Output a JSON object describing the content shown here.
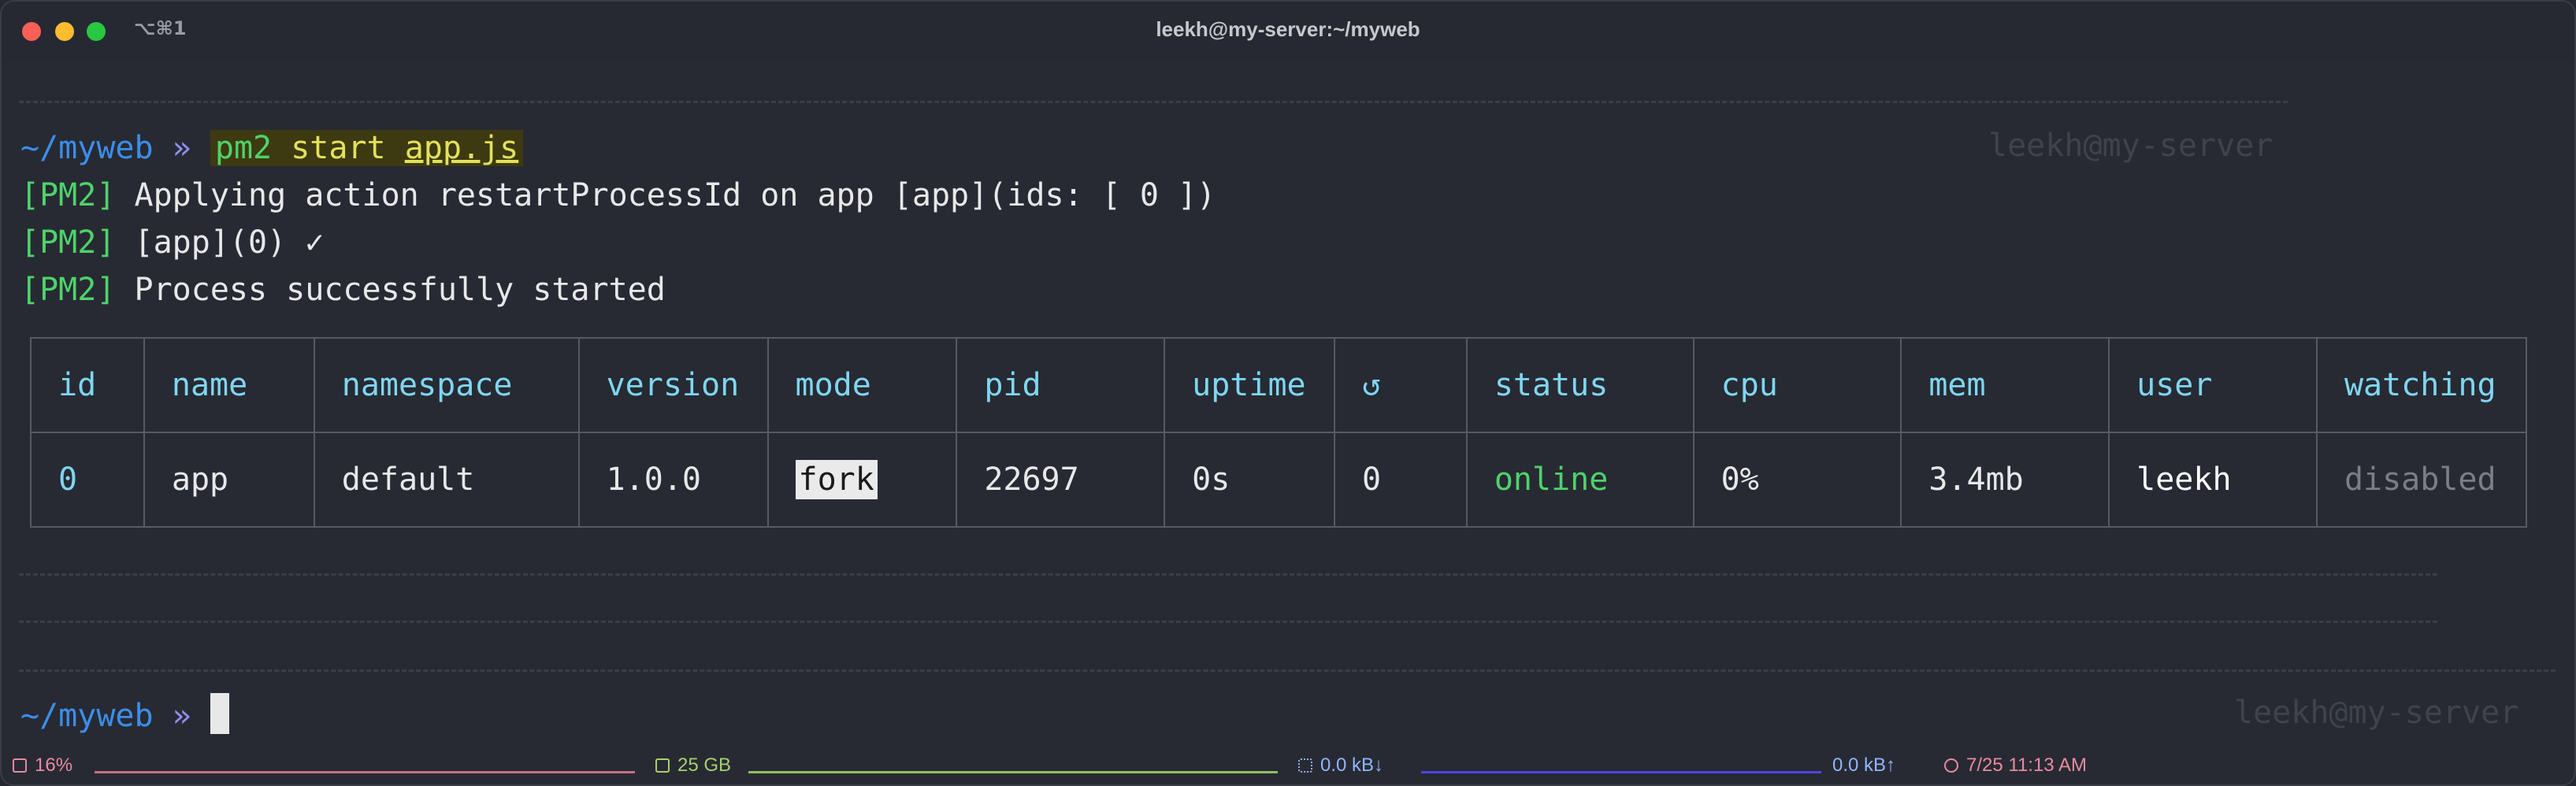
{
  "window": {
    "shortcut": "⌥⌘1",
    "title": "leekh@my-server:~/myweb"
  },
  "prompt1": {
    "dir": "~/myweb",
    "chevron": "»",
    "cmd_pm2": "pm2",
    "cmd_start": "start",
    "cmd_file": "app.js",
    "right": "leekh@my-server"
  },
  "output": [
    {
      "tag": "[PM2]",
      "text": "Applying action restartProcessId on app [app](ids: [ 0 ])"
    },
    {
      "tag": "[PM2]",
      "text": "[app](0) ✓"
    },
    {
      "tag": "[PM2]",
      "text": "Process successfully started"
    }
  ],
  "table": {
    "headers": [
      "id",
      "name",
      "namespace",
      "version",
      "mode",
      "pid",
      "uptime",
      "↺",
      "status",
      "cpu",
      "mem",
      "user",
      "watching"
    ],
    "row": {
      "id": "0",
      "name": "app",
      "namespace": "default",
      "version": "1.0.0",
      "mode": "fork",
      "pid": "22697",
      "uptime": "0s",
      "restarts": "0",
      "status": "online",
      "cpu": "0%",
      "mem": "3.4mb",
      "user": "leekh",
      "watching": "disabled"
    }
  },
  "prompt2": {
    "dir": "~/myweb",
    "chevron": "»",
    "right": "leekh@my-server"
  },
  "statusbar": {
    "cpu": "16%",
    "ram": "25 GB",
    "net_down": "0.0 kB↓",
    "net_up": "0.0 kB↑",
    "time": "7/25 11:13 AM",
    "icons": [
      "cpu-icon",
      "memory-icon",
      "network-icon",
      "clock-icon"
    ]
  },
  "colors": {
    "background": "#272a33",
    "directory": "#3b8eea",
    "pm2_tag": "#4ed36a",
    "header": "#7fd6f0",
    "status_online": "#4ed36a",
    "command": "#e3e15a"
  }
}
